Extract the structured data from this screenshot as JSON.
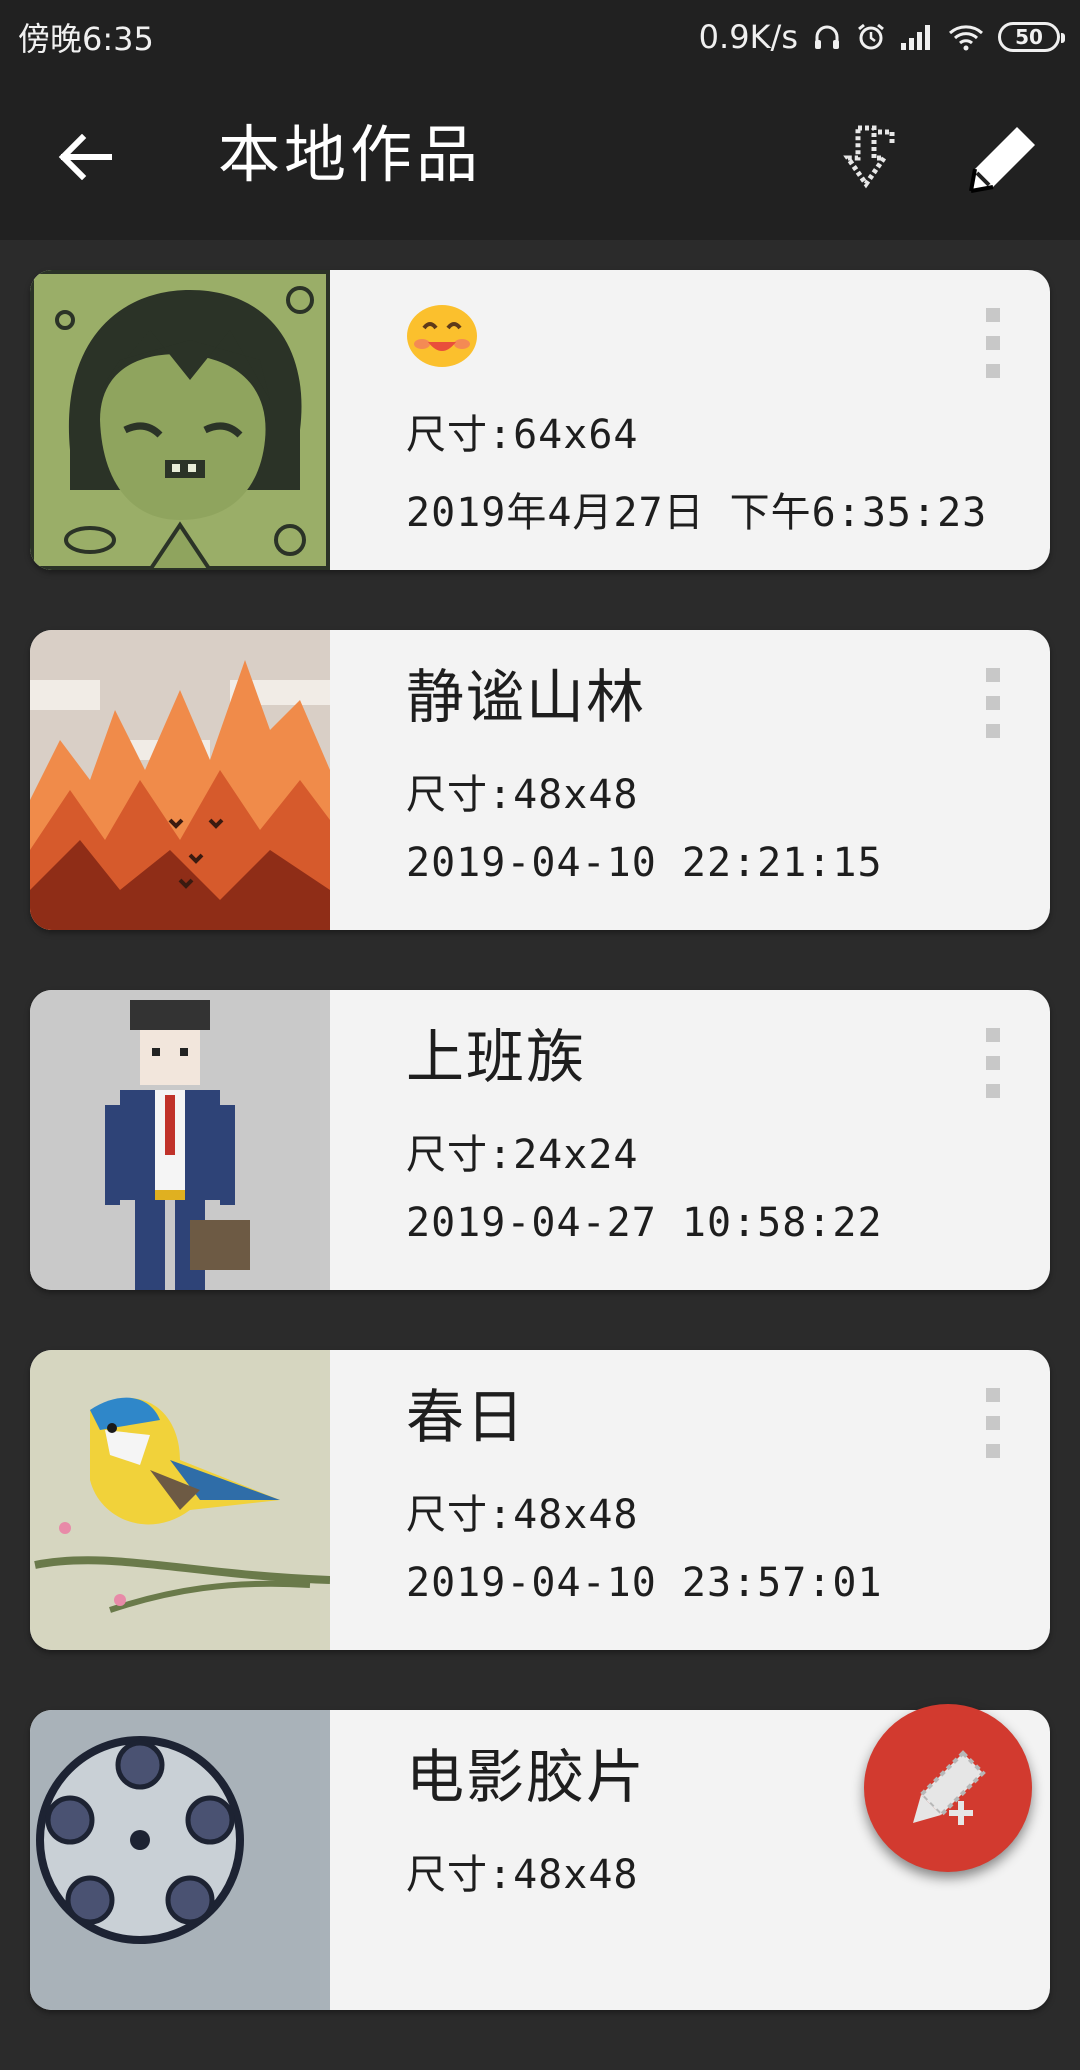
{
  "status_bar": {
    "time": "傍晚6:35",
    "net_speed": "0.9K/s",
    "battery": "50",
    "icons": [
      "headset-icon",
      "alarm-icon",
      "signal-icon",
      "wifi-icon",
      "battery-icon"
    ]
  },
  "app_bar": {
    "title": "本地作品",
    "back_icon": "back-arrow-icon",
    "actions": [
      "import-icon",
      "pencil-icon"
    ]
  },
  "works": [
    {
      "title": "",
      "title_icon": "smiling-face-emoji",
      "size": "尺寸:64x64",
      "date": "2019年4月27日 下午6:35:23",
      "thumb": "green-girl-portrait"
    },
    {
      "title": "静谧山林",
      "size": "尺寸:48x48",
      "date": "2019-04-10 22:21:15",
      "thumb": "autumn-forest"
    },
    {
      "title": "上班族",
      "size": "尺寸:24x24",
      "date": "2019-04-27 10:58:22",
      "thumb": "office-worker"
    },
    {
      "title": "春日",
      "size": "尺寸:48x48",
      "date": "2019-04-10 23:57:01",
      "thumb": "bird-on-branch"
    },
    {
      "title": "电影胶片",
      "size": "尺寸:48x48",
      "date": "",
      "thumb": "film-reel"
    }
  ],
  "fab": {
    "icon": "new-drawing-icon"
  },
  "colors": {
    "background": "#2b2b2b",
    "app_bar": "#212121",
    "card": "#f3f3f3",
    "fab": "#d23a2f"
  }
}
